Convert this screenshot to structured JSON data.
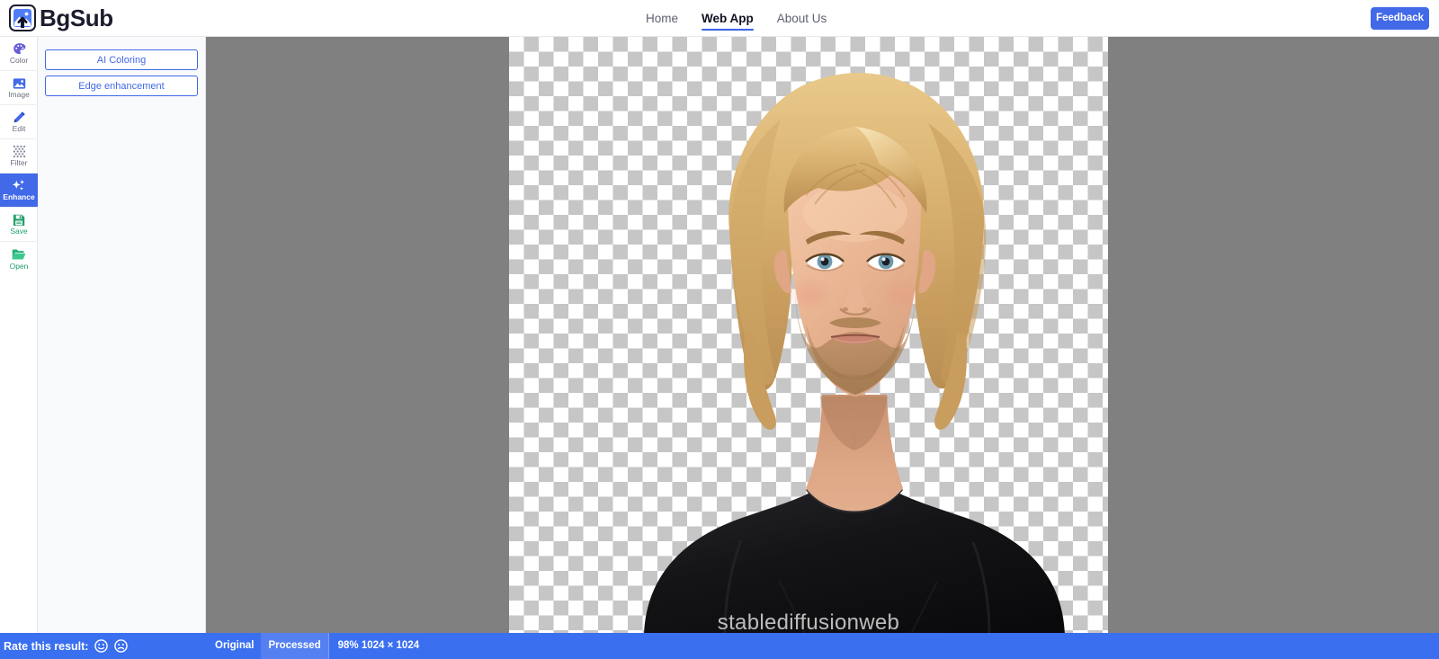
{
  "app": {
    "brand_name": "BgSub",
    "brand_icon": "image-upload-logo-icon"
  },
  "nav": {
    "links": [
      {
        "label": "Home",
        "active": false
      },
      {
        "label": "Web App",
        "active": true
      },
      {
        "label": "About Us",
        "active": false
      }
    ],
    "feedback_label": "Feedback"
  },
  "rail": {
    "items": [
      {
        "label": "Color",
        "icon": "palette-icon",
        "active": false,
        "color": "#6a5cd6"
      },
      {
        "label": "Image",
        "icon": "picture-icon",
        "active": false,
        "color": "#4169e8"
      },
      {
        "label": "Edit",
        "icon": "pencil-icon",
        "active": false,
        "color": "#4169e8"
      },
      {
        "label": "Filter",
        "icon": "halftone-grid-icon",
        "active": false,
        "color": "#7b8096"
      },
      {
        "label": "Enhance",
        "icon": "sparkles-icon",
        "active": true,
        "color": "#ffffff"
      },
      {
        "label": "Save",
        "icon": "floppy-disk-icon",
        "active": false,
        "color": "#22a06b"
      },
      {
        "label": "Open",
        "icon": "folder-open-icon",
        "active": false,
        "color": "#22a06b"
      }
    ]
  },
  "panel": {
    "buttons": [
      {
        "label": "AI Coloring"
      },
      {
        "label": "Edge enhancement"
      }
    ]
  },
  "canvas": {
    "watermark": "stablediffusionweb",
    "alpha_background": "checkerboard"
  },
  "statusbar": {
    "rate_label": "Rate this result:",
    "face_positive": "smiley-face-icon",
    "face_negative": "frowning-face-icon",
    "tabs": [
      {
        "label": "Original",
        "selected": false
      },
      {
        "label": "Processed",
        "selected": true
      }
    ],
    "zoom_info": "98% 1024 × 1024"
  },
  "colors": {
    "accent": "#4169e8",
    "statusbar": "#3a6ff0",
    "canvas_bg": "#808080",
    "green": "#22a06b"
  }
}
